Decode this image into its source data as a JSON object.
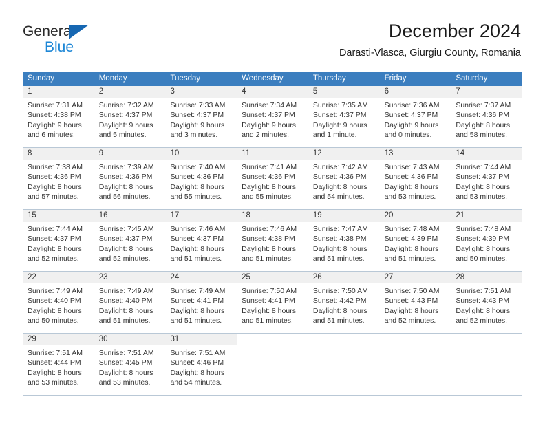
{
  "brand": {
    "name_top": "General",
    "name_bottom": "Blue",
    "accent_dark": "#1667b2",
    "accent_light": "#1e87d6"
  },
  "header": {
    "title": "December 2024",
    "subtitle": "Darasti-Vlasca, Giurgiu County, Romania"
  },
  "calendar": {
    "header_color": "#3b7ebf",
    "weekdays": [
      "Sunday",
      "Monday",
      "Tuesday",
      "Wednesday",
      "Thursday",
      "Friday",
      "Saturday"
    ],
    "weeks": [
      [
        {
          "day": "1",
          "sunrise": "Sunrise: 7:31 AM",
          "sunset": "Sunset: 4:38 PM",
          "daylight1": "Daylight: 9 hours",
          "daylight2": "and 6 minutes."
        },
        {
          "day": "2",
          "sunrise": "Sunrise: 7:32 AM",
          "sunset": "Sunset: 4:37 PM",
          "daylight1": "Daylight: 9 hours",
          "daylight2": "and 5 minutes."
        },
        {
          "day": "3",
          "sunrise": "Sunrise: 7:33 AM",
          "sunset": "Sunset: 4:37 PM",
          "daylight1": "Daylight: 9 hours",
          "daylight2": "and 3 minutes."
        },
        {
          "day": "4",
          "sunrise": "Sunrise: 7:34 AM",
          "sunset": "Sunset: 4:37 PM",
          "daylight1": "Daylight: 9 hours",
          "daylight2": "and 2 minutes."
        },
        {
          "day": "5",
          "sunrise": "Sunrise: 7:35 AM",
          "sunset": "Sunset: 4:37 PM",
          "daylight1": "Daylight: 9 hours",
          "daylight2": "and 1 minute."
        },
        {
          "day": "6",
          "sunrise": "Sunrise: 7:36 AM",
          "sunset": "Sunset: 4:37 PM",
          "daylight1": "Daylight: 9 hours",
          "daylight2": "and 0 minutes."
        },
        {
          "day": "7",
          "sunrise": "Sunrise: 7:37 AM",
          "sunset": "Sunset: 4:36 PM",
          "daylight1": "Daylight: 8 hours",
          "daylight2": "and 58 minutes."
        }
      ],
      [
        {
          "day": "8",
          "sunrise": "Sunrise: 7:38 AM",
          "sunset": "Sunset: 4:36 PM",
          "daylight1": "Daylight: 8 hours",
          "daylight2": "and 57 minutes."
        },
        {
          "day": "9",
          "sunrise": "Sunrise: 7:39 AM",
          "sunset": "Sunset: 4:36 PM",
          "daylight1": "Daylight: 8 hours",
          "daylight2": "and 56 minutes."
        },
        {
          "day": "10",
          "sunrise": "Sunrise: 7:40 AM",
          "sunset": "Sunset: 4:36 PM",
          "daylight1": "Daylight: 8 hours",
          "daylight2": "and 55 minutes."
        },
        {
          "day": "11",
          "sunrise": "Sunrise: 7:41 AM",
          "sunset": "Sunset: 4:36 PM",
          "daylight1": "Daylight: 8 hours",
          "daylight2": "and 55 minutes."
        },
        {
          "day": "12",
          "sunrise": "Sunrise: 7:42 AM",
          "sunset": "Sunset: 4:36 PM",
          "daylight1": "Daylight: 8 hours",
          "daylight2": "and 54 minutes."
        },
        {
          "day": "13",
          "sunrise": "Sunrise: 7:43 AM",
          "sunset": "Sunset: 4:36 PM",
          "daylight1": "Daylight: 8 hours",
          "daylight2": "and 53 minutes."
        },
        {
          "day": "14",
          "sunrise": "Sunrise: 7:44 AM",
          "sunset": "Sunset: 4:37 PM",
          "daylight1": "Daylight: 8 hours",
          "daylight2": "and 53 minutes."
        }
      ],
      [
        {
          "day": "15",
          "sunrise": "Sunrise: 7:44 AM",
          "sunset": "Sunset: 4:37 PM",
          "daylight1": "Daylight: 8 hours",
          "daylight2": "and 52 minutes."
        },
        {
          "day": "16",
          "sunrise": "Sunrise: 7:45 AM",
          "sunset": "Sunset: 4:37 PM",
          "daylight1": "Daylight: 8 hours",
          "daylight2": "and 52 minutes."
        },
        {
          "day": "17",
          "sunrise": "Sunrise: 7:46 AM",
          "sunset": "Sunset: 4:37 PM",
          "daylight1": "Daylight: 8 hours",
          "daylight2": "and 51 minutes."
        },
        {
          "day": "18",
          "sunrise": "Sunrise: 7:46 AM",
          "sunset": "Sunset: 4:38 PM",
          "daylight1": "Daylight: 8 hours",
          "daylight2": "and 51 minutes."
        },
        {
          "day": "19",
          "sunrise": "Sunrise: 7:47 AM",
          "sunset": "Sunset: 4:38 PM",
          "daylight1": "Daylight: 8 hours",
          "daylight2": "and 51 minutes."
        },
        {
          "day": "20",
          "sunrise": "Sunrise: 7:48 AM",
          "sunset": "Sunset: 4:39 PM",
          "daylight1": "Daylight: 8 hours",
          "daylight2": "and 51 minutes."
        },
        {
          "day": "21",
          "sunrise": "Sunrise: 7:48 AM",
          "sunset": "Sunset: 4:39 PM",
          "daylight1": "Daylight: 8 hours",
          "daylight2": "and 50 minutes."
        }
      ],
      [
        {
          "day": "22",
          "sunrise": "Sunrise: 7:49 AM",
          "sunset": "Sunset: 4:40 PM",
          "daylight1": "Daylight: 8 hours",
          "daylight2": "and 50 minutes."
        },
        {
          "day": "23",
          "sunrise": "Sunrise: 7:49 AM",
          "sunset": "Sunset: 4:40 PM",
          "daylight1": "Daylight: 8 hours",
          "daylight2": "and 51 minutes."
        },
        {
          "day": "24",
          "sunrise": "Sunrise: 7:49 AM",
          "sunset": "Sunset: 4:41 PM",
          "daylight1": "Daylight: 8 hours",
          "daylight2": "and 51 minutes."
        },
        {
          "day": "25",
          "sunrise": "Sunrise: 7:50 AM",
          "sunset": "Sunset: 4:41 PM",
          "daylight1": "Daylight: 8 hours",
          "daylight2": "and 51 minutes."
        },
        {
          "day": "26",
          "sunrise": "Sunrise: 7:50 AM",
          "sunset": "Sunset: 4:42 PM",
          "daylight1": "Daylight: 8 hours",
          "daylight2": "and 51 minutes."
        },
        {
          "day": "27",
          "sunrise": "Sunrise: 7:50 AM",
          "sunset": "Sunset: 4:43 PM",
          "daylight1": "Daylight: 8 hours",
          "daylight2": "and 52 minutes."
        },
        {
          "day": "28",
          "sunrise": "Sunrise: 7:51 AM",
          "sunset": "Sunset: 4:43 PM",
          "daylight1": "Daylight: 8 hours",
          "daylight2": "and 52 minutes."
        }
      ],
      [
        {
          "day": "29",
          "sunrise": "Sunrise: 7:51 AM",
          "sunset": "Sunset: 4:44 PM",
          "daylight1": "Daylight: 8 hours",
          "daylight2": "and 53 minutes."
        },
        {
          "day": "30",
          "sunrise": "Sunrise: 7:51 AM",
          "sunset": "Sunset: 4:45 PM",
          "daylight1": "Daylight: 8 hours",
          "daylight2": "and 53 minutes."
        },
        {
          "day": "31",
          "sunrise": "Sunrise: 7:51 AM",
          "sunset": "Sunset: 4:46 PM",
          "daylight1": "Daylight: 8 hours",
          "daylight2": "and 54 minutes."
        },
        {
          "day": "",
          "sunrise": "",
          "sunset": "",
          "daylight1": "",
          "daylight2": ""
        },
        {
          "day": "",
          "sunrise": "",
          "sunset": "",
          "daylight1": "",
          "daylight2": ""
        },
        {
          "day": "",
          "sunrise": "",
          "sunset": "",
          "daylight1": "",
          "daylight2": ""
        },
        {
          "day": "",
          "sunrise": "",
          "sunset": "",
          "daylight1": "",
          "daylight2": ""
        }
      ]
    ]
  }
}
